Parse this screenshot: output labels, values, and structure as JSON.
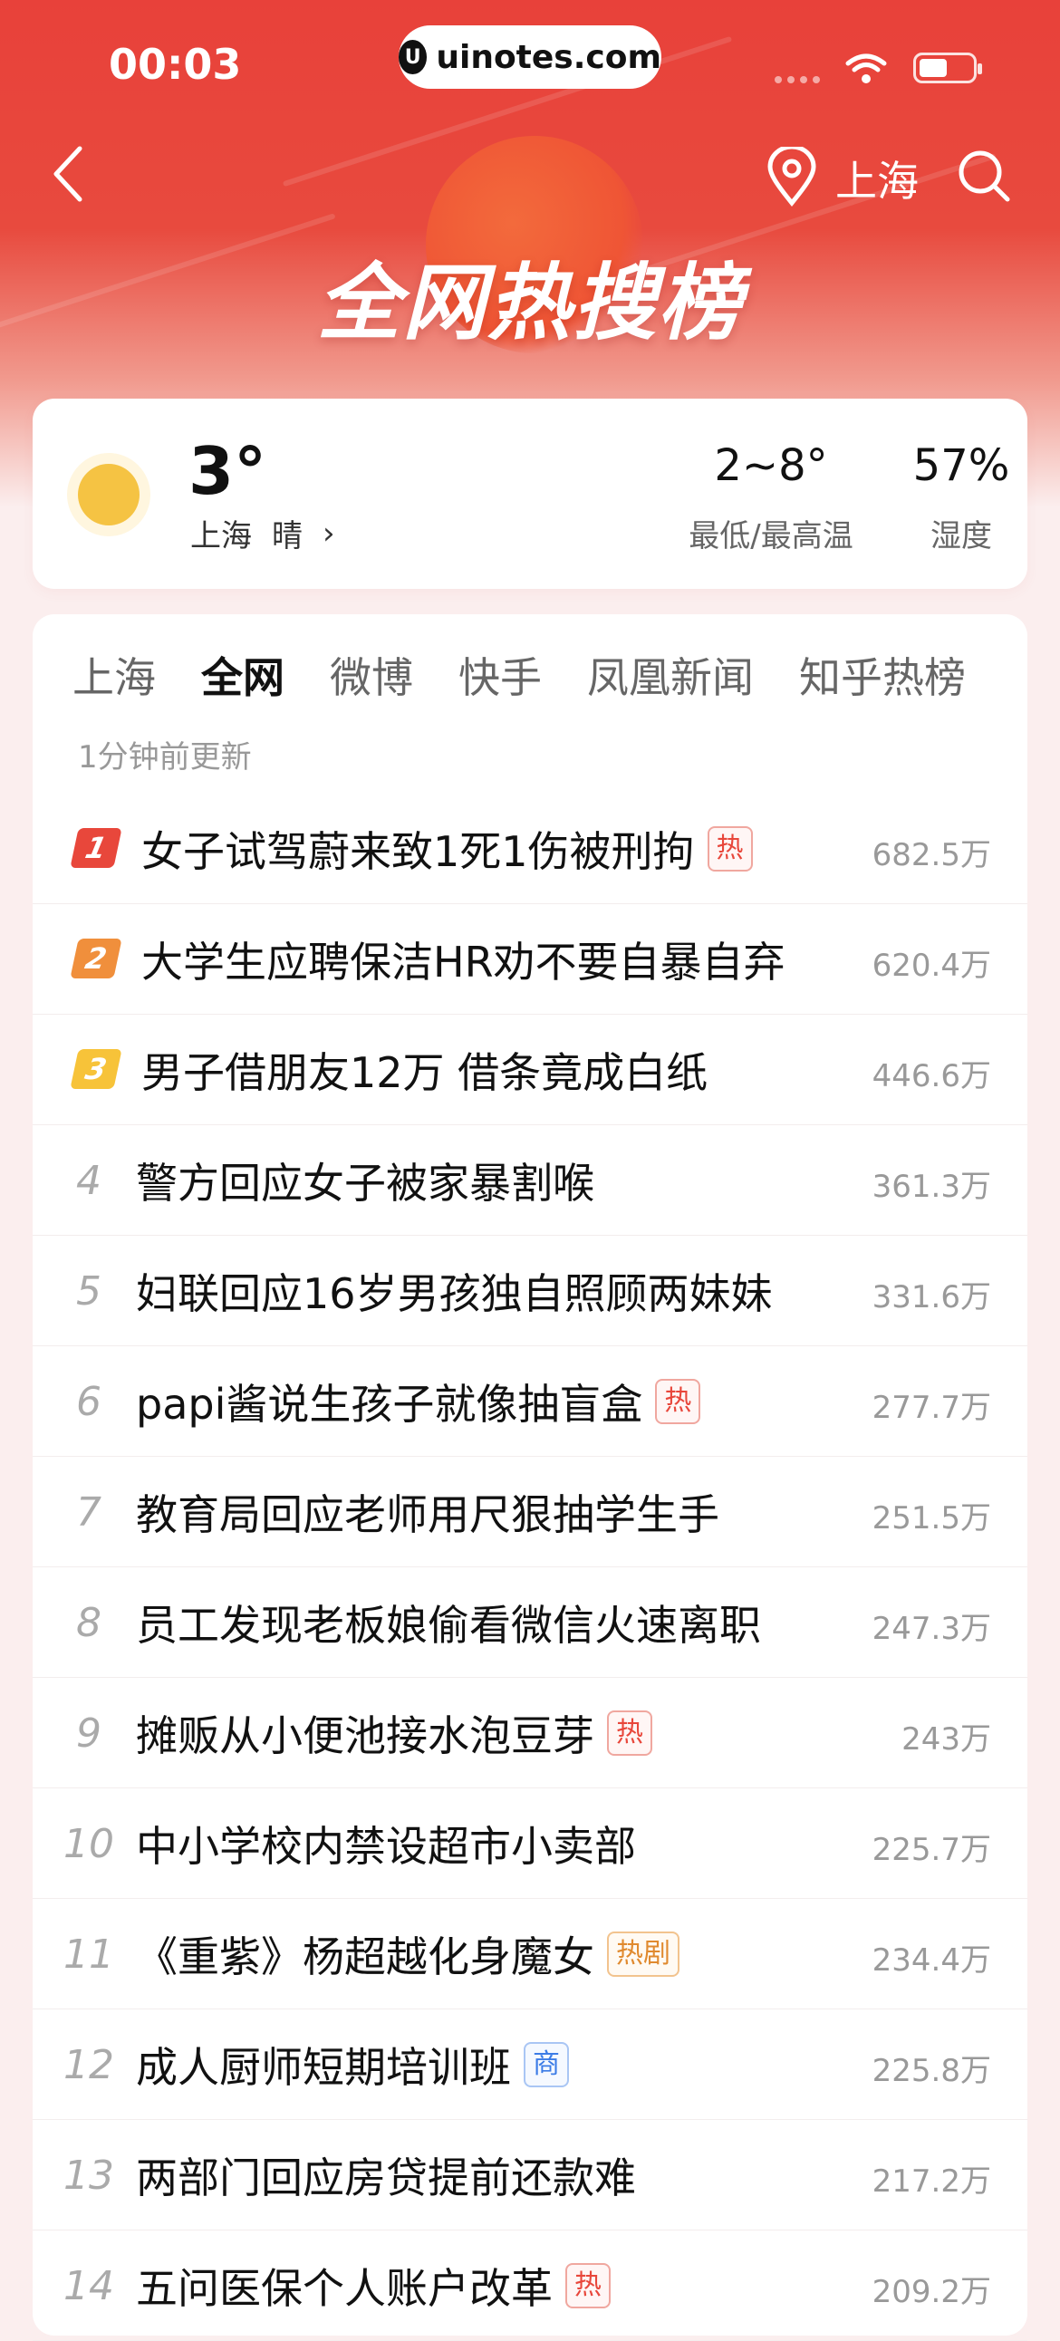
{
  "status_bar": {
    "time": "00:03",
    "site": "uinotes.com"
  },
  "header": {
    "location": "上海",
    "title": "全网热搜榜"
  },
  "weather": {
    "temp": "3°",
    "city": "上海",
    "condition": "晴",
    "range": "2~8°",
    "range_label": "最低/最高温",
    "humidity": "57%",
    "humidity_label": "湿度"
  },
  "tabs": [
    {
      "label": "上海",
      "active": false
    },
    {
      "label": "全网",
      "active": true
    },
    {
      "label": "微博",
      "active": false
    },
    {
      "label": "快手",
      "active": false
    },
    {
      "label": "凤凰新闻",
      "active": false
    },
    {
      "label": "知乎热榜",
      "active": false
    }
  ],
  "updated": "1分钟前更新",
  "items": [
    {
      "rank": "1",
      "title": "女子试驾蔚来致1死1伤被刑拘",
      "tag": "热",
      "tag_type": "hot",
      "count": "682.5万"
    },
    {
      "rank": "2",
      "title": "大学生应聘保洁HR劝不要自暴自弃",
      "tag": "",
      "tag_type": "",
      "count": "620.4万"
    },
    {
      "rank": "3",
      "title": "男子借朋友12万 借条竟成白纸",
      "tag": "",
      "tag_type": "",
      "count": "446.6万"
    },
    {
      "rank": "4",
      "title": "警方回应女子被家暴割喉",
      "tag": "",
      "tag_type": "",
      "count": "361.3万"
    },
    {
      "rank": "5",
      "title": "妇联回应16岁男孩独自照顾两妹妹",
      "tag": "",
      "tag_type": "",
      "count": "331.6万"
    },
    {
      "rank": "6",
      "title": "papi酱说生孩子就像抽盲盒",
      "tag": "热",
      "tag_type": "hot",
      "count": "277.7万"
    },
    {
      "rank": "7",
      "title": "教育局回应老师用尺狠抽学生手",
      "tag": "",
      "tag_type": "",
      "count": "251.5万"
    },
    {
      "rank": "8",
      "title": "员工发现老板娘偷看微信火速离职",
      "tag": "",
      "tag_type": "",
      "count": "247.3万"
    },
    {
      "rank": "9",
      "title": "摊贩从小便池接水泡豆芽",
      "tag": "热",
      "tag_type": "hot",
      "count": "243万"
    },
    {
      "rank": "10",
      "title": "中小学校内禁设超市小卖部",
      "tag": "",
      "tag_type": "",
      "count": "225.7万"
    },
    {
      "rank": "11",
      "title": "《重紫》杨超越化身魔女",
      "tag": "热剧",
      "tag_type": "drama",
      "count": "234.4万"
    },
    {
      "rank": "12",
      "title": "成人厨师短期培训班",
      "tag": "商",
      "tag_type": "biz",
      "count": "225.8万"
    },
    {
      "rank": "13",
      "title": "两部门回应房贷提前还款难",
      "tag": "",
      "tag_type": "",
      "count": "217.2万"
    },
    {
      "rank": "14",
      "title": "五问医保个人账户改革",
      "tag": "热",
      "tag_type": "hot",
      "count": "209.2万"
    }
  ]
}
